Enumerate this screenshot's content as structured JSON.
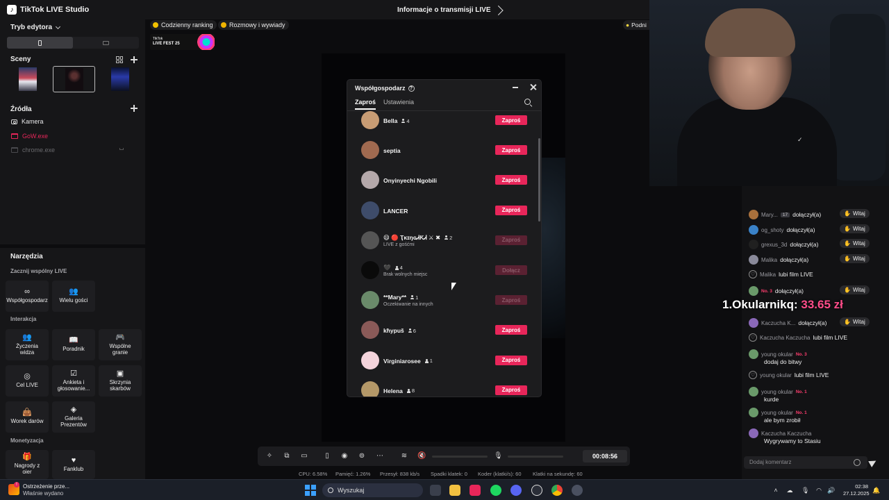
{
  "app": {
    "title": "TikTok LIVE Studio",
    "center_title": "Informacje o transmisji LIVE"
  },
  "left_panel": {
    "editor_mode": "Tryb edytora",
    "scenes_title": "Sceny",
    "sources_title": "Źródła",
    "sources": [
      {
        "label": "Kamera",
        "color": "#e8e8ea"
      },
      {
        "label": "GoW.exe",
        "color": "#e8265a"
      },
      {
        "label": "chrome.exe",
        "color": "#6a6a6e"
      }
    ]
  },
  "tools": {
    "title": "Narzędzia",
    "sections": {
      "multi_live": "Zacznij wspólny LIVE",
      "interaction": "Interakcja",
      "monetization": "Monetyzacja"
    },
    "multi_live_items": [
      "Współgospodarz",
      "Wielu gości"
    ],
    "interaction_items": [
      "Życzenia widza",
      "Poradnik",
      "Wspólne granie",
      "Cel LIVE",
      "Ankieta i głosowanie...",
      "Skrzynia skarbów",
      "Worek darów",
      "Galeria Prezentów"
    ],
    "monetization_items": [
      "Nagrody z oier",
      "Fanklub"
    ]
  },
  "top_tags": [
    "Codzienny ranking",
    "Rozmowy i wywiady"
  ],
  "bulb_tag": "Podni",
  "live_fest": {
    "line1": "TikTok",
    "line2": "LIVE FEST 25"
  },
  "cohost_modal": {
    "title": "Współgospodarz",
    "tabs": [
      "Zaproś",
      "Ustawienia"
    ],
    "rows": [
      {
        "name": "Bella",
        "count": "4",
        "status": "",
        "button": "Zaproś",
        "disabled": false,
        "avatar": "#c89c74"
      },
      {
        "name": "septia",
        "count": "",
        "status": "",
        "button": "Zaproś",
        "disabled": false,
        "avatar": "#a06a50"
      },
      {
        "name": "Onyinyechi Ngobili",
        "count": "",
        "status": "",
        "button": "Zaproś",
        "disabled": false,
        "avatar": "#b4a8aa"
      },
      {
        "name": "LANCER",
        "count": "",
        "status": "",
        "button": "Zaproś",
        "disabled": false,
        "avatar": "#3e4c6a"
      },
      {
        "name": "😄 🔴 ҬĸɪŋɢᏗƘᏗ ⚔ ✖",
        "count": "2",
        "status": "LIVE z gośćmi",
        "button": "Zaproś",
        "disabled": true,
        "avatar": "#555555"
      },
      {
        "name": "🖤",
        "count": "4",
        "status": "Brak wolnych miejsc",
        "button": "Dołącz",
        "disabled": true,
        "avatar": "#0a0a0a"
      },
      {
        "name": "**Mary**",
        "count": "1",
        "status": "Oczekiwanie na innych",
        "button": "Zaproś",
        "disabled": true,
        "avatar": "#6a8a6a"
      },
      {
        "name": "kħypuš",
        "count": "6",
        "status": "",
        "button": "Zaproś",
        "disabled": false,
        "avatar": "#8a5a58"
      },
      {
        "name": "Virginiarosee",
        "count": "1",
        "status": "",
        "button": "Zaproś",
        "disabled": false,
        "avatar": "#f4d4dc"
      },
      {
        "name": "Helena",
        "count": "8",
        "status": "",
        "button": "Zaproś",
        "disabled": false,
        "avatar": "#b49868"
      }
    ]
  },
  "toolbar": {
    "timer": "00:08:56"
  },
  "stats": {
    "cpu": "CPU: 6.58%",
    "memory": "Pamięć: 1.26%",
    "bandwidth": "Przesył: 838 kb/s",
    "dropped": "Spadki klatek: 0",
    "encoder": "Koder (klatki/s): 60",
    "fps": "Klatki na sekundę: 60"
  },
  "chat": {
    "rows": [
      {
        "name": "Mary...",
        "badge": "17",
        "text": "dołączył(a)",
        "witaj": true,
        "avatar": "#a8703c"
      },
      {
        "name": "og_shoty",
        "badge": "",
        "text": "dołączył(a)",
        "witaj": true,
        "avatar": "#3a82c8"
      },
      {
        "name": "grexus_3d",
        "badge": "",
        "text": "dołączył(a)",
        "witaj": true,
        "avatar": "#202020"
      },
      {
        "name": "Malika",
        "badge": "",
        "text": "dołączył(a)",
        "witaj": true,
        "avatar": "#8a8a9a"
      },
      {
        "name": "Malika",
        "badge": "",
        "text": "lubi film LIVE",
        "witaj": false,
        "avatar": "heart"
      },
      {
        "name": "",
        "badge": "No. 3",
        "text": "dołączył(a)",
        "witaj": true,
        "avatar": "#6a9a6a"
      },
      {
        "name": "Kaczucha K...",
        "badge": "",
        "text": "dołączył(a)",
        "witaj": true,
        "avatar": "#8a68b8"
      },
      {
        "name": "Kaczucha Kaczucha",
        "badge": "",
        "text": "lubi film LIVE",
        "witaj": false,
        "avatar": "heart"
      }
    ],
    "witaj_label": "Witaj",
    "messages": [
      {
        "name": "young okular",
        "rank": "No. 3",
        "text": "dodaj do bitwy"
      },
      {
        "name": "young okular",
        "rank": "",
        "text": "lubi film LIVE"
      },
      {
        "name": "young okular",
        "rank": "No. 1",
        "text": "kurde"
      },
      {
        "name": "young okular",
        "rank": "No. 1",
        "text": "ale bym zrobił"
      },
      {
        "name": "Kaczucha Kaczucha",
        "rank": "",
        "text": "Wygrywamy to Stasiu"
      }
    ],
    "overlay_rank": "1.Okularnikq:",
    "overlay_amount": "33.65 zł",
    "comment_placeholder": "Dodaj komentarz"
  },
  "taskbar": {
    "warning_title": "Ostrzeżenie prze...",
    "warning_sub": "Właśnie wydano",
    "search": "Wyszukaj",
    "time": "02:38",
    "date": "27.12.2025"
  }
}
